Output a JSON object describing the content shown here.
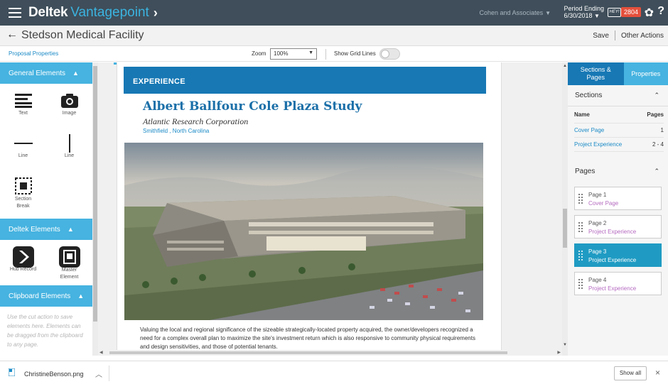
{
  "app": {
    "brand": "Deltek",
    "brand_sub": "Vantagepoint",
    "brand_chevron": "›",
    "company": "Cohen and Associates",
    "period_line1": "Period Ending",
    "period_line2": "6/30/2018",
    "hey_label": "HEY!",
    "notification_count": "2804",
    "help_label": "?"
  },
  "title_bar": {
    "back_arrow": "←",
    "page_title": "Stedson Medical Facility",
    "save_label": "Save",
    "other_actions_label": "Other Actions"
  },
  "toolbar": {
    "proposal_properties": "Proposal Properties",
    "zoom_label": "Zoom",
    "zoom_value": "100%",
    "grid_lines_label": "Show Grid Lines",
    "grid_lines_on": false
  },
  "left_panel": {
    "general_header": "General Elements",
    "general_items": [
      {
        "label": "Text",
        "icon": "text-lines-icon"
      },
      {
        "label": "Image",
        "icon": "camera-icon"
      },
      {
        "label": "Line",
        "icon": "horizontal-line-icon"
      },
      {
        "label": "Line",
        "icon": "vertical-line-icon"
      },
      {
        "label": "Section Break",
        "icon": "section-break-icon"
      }
    ],
    "deltek_header": "Deltek Elements",
    "deltek_items": [
      {
        "label": "Hub Record",
        "icon": "hub-record-icon"
      },
      {
        "label": "Master Element",
        "icon": "master-element-icon"
      }
    ],
    "clipboard_header": "Clipboard Elements",
    "clipboard_text": "Use the cut action to save elements here. Elements can be dragged from the clipboard to any page."
  },
  "canvas": {
    "section_bar": "EXPERIENCE",
    "project_title": "Albert Ballfour Cole Plaza Study",
    "client": "Atlantic Research Corporation",
    "location": "Smithfield , North Carolina",
    "description": "Valuing the local and regional significance of the sizeable strategically-located property acquired, the owner/developers recognized a need for a complex overall plan to maximize the site's investment return which is also responsive to community physical requirements and design sensitivities, and those of potential tenants."
  },
  "right_panel": {
    "tab_sections": "Sections & Pages",
    "tab_properties": "Properties",
    "sections_header": "Sections",
    "col_name": "Name",
    "col_pages": "Pages",
    "sections": [
      {
        "name": "Cover Page",
        "pages": "1"
      },
      {
        "name": "Project Experience",
        "pages": "2 - 4"
      }
    ],
    "pages_header": "Pages",
    "pages": [
      {
        "name": "Page 1",
        "section": "Cover Page",
        "active": false
      },
      {
        "name": "Page 2",
        "section": "Project Experience",
        "active": false
      },
      {
        "name": "Page 3",
        "section": "Project Experience",
        "active": true
      },
      {
        "name": "Page 4",
        "section": "Project Experience",
        "active": false
      }
    ]
  },
  "download_bar": {
    "file_name": "ChristineBenson.png",
    "show_all": "Show all",
    "close_label": "×"
  },
  "colors": {
    "topbar": "#3f4e5a",
    "accent_light": "#46b3e0",
    "accent_dark": "#1778b4",
    "badge": "#e4503c",
    "link": "#1a8ac6"
  }
}
